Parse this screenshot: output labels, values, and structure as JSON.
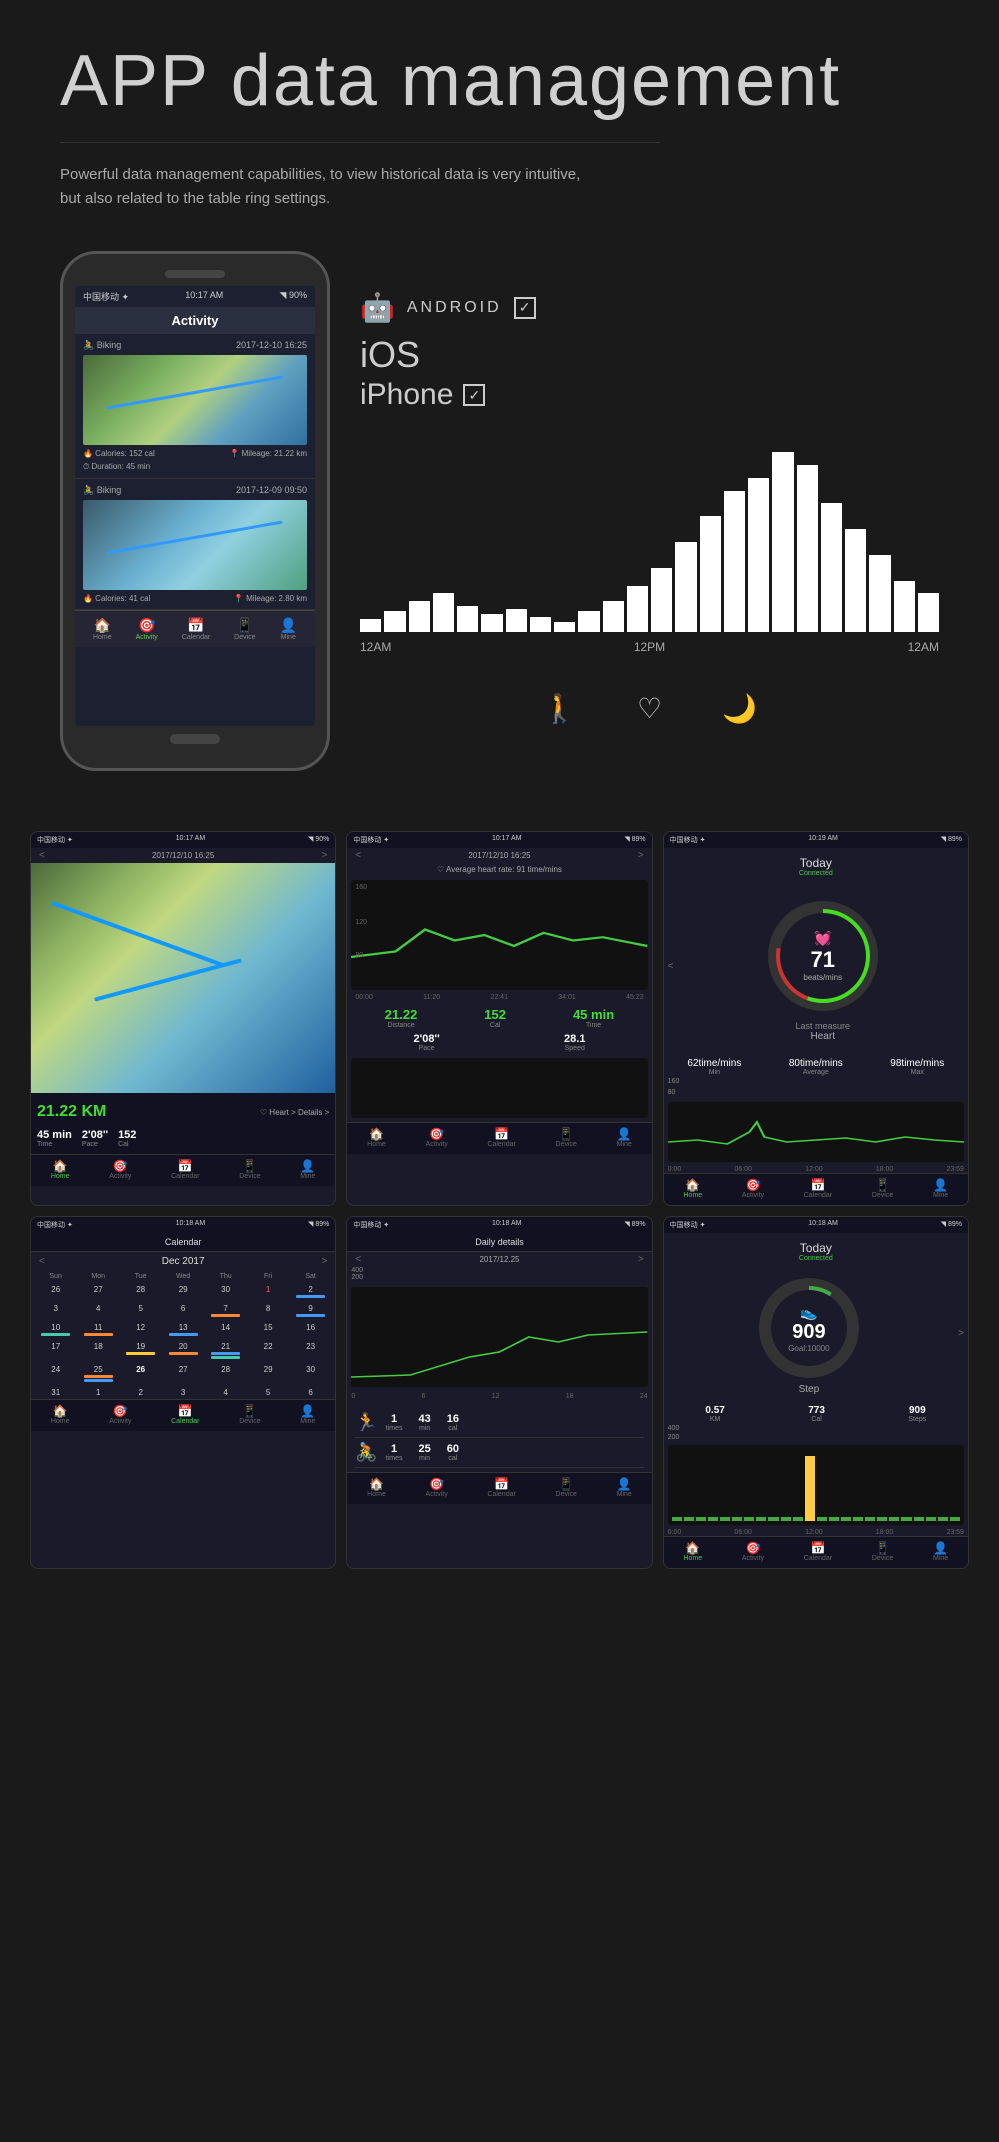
{
  "header": {
    "title": "APP data management",
    "subtitle_line1": "Powerful data management capabilities, to view historical data is very intuitive,",
    "subtitle_line2": "but also related to the table ring settings."
  },
  "os_support": {
    "android_label": "ANDROID",
    "ios_label": "iOS",
    "iphone_label": "iPhone",
    "check_symbol": "✓"
  },
  "chart": {
    "labels": [
      "12AM",
      "12PM",
      "12AM"
    ],
    "icons": [
      "🚶",
      "♡",
      "🌙"
    ],
    "bars": [
      5,
      8,
      12,
      15,
      10,
      7,
      9,
      6,
      4,
      8,
      12,
      18,
      25,
      35,
      45,
      55,
      60,
      70,
      65,
      50,
      40,
      30,
      20,
      15
    ]
  },
  "phone_screen": {
    "status_bar": {
      "carrier": "中国移动 ✦",
      "time": "10:17 AM",
      "signal": "◥ 90%"
    },
    "app_title": "Activity",
    "activities": [
      {
        "type": "Biking",
        "date": "2017-12-10 16:25",
        "calories": "Calories: 152 cal",
        "mileage": "Mileage: 21.22 km",
        "duration": "Duration: 45 min"
      },
      {
        "type": "Biking",
        "date": "2017-12-09 09:50",
        "calories": "Calories: 41 cal",
        "mileage": "Mileage: 2.80 km",
        "duration": ""
      }
    ],
    "nav_items": [
      "Home",
      "Activity",
      "Calendar",
      "Device",
      "Mine"
    ]
  },
  "screenshots": {
    "row1": [
      {
        "id": "map",
        "status": "中国移动 ✦  10:17 AM  ◥ 90%",
        "date": "2017/12/10 16:25",
        "distance": "21.22 KM",
        "heart_label": "Heart",
        "time": "45 min",
        "time_label": "Time",
        "pace": "2'08''",
        "pace_label": "Pace",
        "cal": "152",
        "cal_label": "Cal"
      },
      {
        "id": "heart_rate_chart",
        "status": "中国移动 ✦  10:17 AM  ◥ 89%",
        "date": "2017/12/10 16:25",
        "avg_hr": "Average heart rate: 91 time/mins",
        "y_labels": [
          "160",
          "120",
          "80"
        ],
        "x_labels": [
          "00:00",
          "11:20",
          "22:41",
          "34:01",
          "45:22"
        ],
        "distance_label": "Distance",
        "cal_label": "Cal",
        "time_label": "Time",
        "distance_val": "21.22",
        "cal_val": "152",
        "time_val": "45 min",
        "pace_label": "Pace",
        "speed_label": "Speed",
        "pace_val": "2'08''",
        "speed_val": "28.1"
      },
      {
        "id": "heart_rate_circle",
        "status": "中国移动 ✦  10:19 AM  ◥ 89%",
        "today": "Today",
        "connected": "Connected",
        "hr_value": "71",
        "hr_unit": "beats/mins",
        "hr_sublabel": "Last measure",
        "hr_label": "Heart",
        "min_label": "Min",
        "avg_label": "Average",
        "max_label": "Max",
        "min_val": "62time/mins",
        "avg_val": "80time/mins",
        "max_val": "98time/mins",
        "time_labels": [
          "0:00",
          "06:00",
          "12:00",
          "18:00",
          "23:59"
        ]
      }
    ],
    "row2": [
      {
        "id": "calendar",
        "status": "中国移动 ✦  10:18 AM  ◥ 89%",
        "title": "Calendar",
        "month": "Dec 2017",
        "day_headers": [
          "Sun",
          "Mon",
          "Tue",
          "Wed",
          "Thu",
          "Fri",
          "Sat"
        ],
        "weeks": [
          [
            "26",
            "27",
            "28",
            "29",
            "30",
            "1",
            "2"
          ],
          [
            "3",
            "4",
            "5",
            "6",
            "7",
            "8",
            "9"
          ],
          [
            "10",
            "11",
            "12",
            "13",
            "14",
            "15",
            "16"
          ],
          [
            "17",
            "18",
            "19",
            "20",
            "21",
            "22",
            "23"
          ],
          [
            "24",
            "25",
            "26",
            "27",
            "28",
            "29",
            "30"
          ],
          [
            "31",
            "1",
            "2",
            "3",
            "4",
            "5",
            "6"
          ]
        ]
      },
      {
        "id": "daily_details",
        "status": "中国移动 ✦  10:18 AM  ◥ 89%",
        "title": "Daily details",
        "date": "2017/12.25",
        "y_labels": [
          "400",
          "200"
        ],
        "x_labels": [
          "0",
          "6",
          "12",
          "18",
          "24"
        ],
        "activities": [
          {
            "icon": "🏃",
            "times": "1",
            "times_label": "times",
            "duration": "43",
            "duration_label": "min",
            "cal": "16",
            "cal_label": "cal"
          },
          {
            "icon": "🚴",
            "times": "1",
            "times_label": "times",
            "duration": "25",
            "duration_label": "min",
            "cal": "60",
            "cal_label": "cal"
          }
        ]
      },
      {
        "id": "steps",
        "status": "中国移动 ✦  10:18 AM  ◥ 89%",
        "today": "Today",
        "connected": "Connected",
        "step_value": "909",
        "step_goal": "Goal:10000",
        "step_label": "Step",
        "km_label": "KM",
        "cal_label": "Cal",
        "steps_label": "Steps",
        "km_val": "0.57",
        "cal_val": "773",
        "steps_val": "909",
        "time_labels": [
          "0:00",
          "06:00",
          "12:00",
          "18:00",
          "23:59"
        ],
        "y_labels": [
          "400",
          "200"
        ]
      }
    ]
  },
  "nav": {
    "items": [
      "Home",
      "Activity",
      "Calendar",
      "Device",
      "Mine"
    ]
  }
}
